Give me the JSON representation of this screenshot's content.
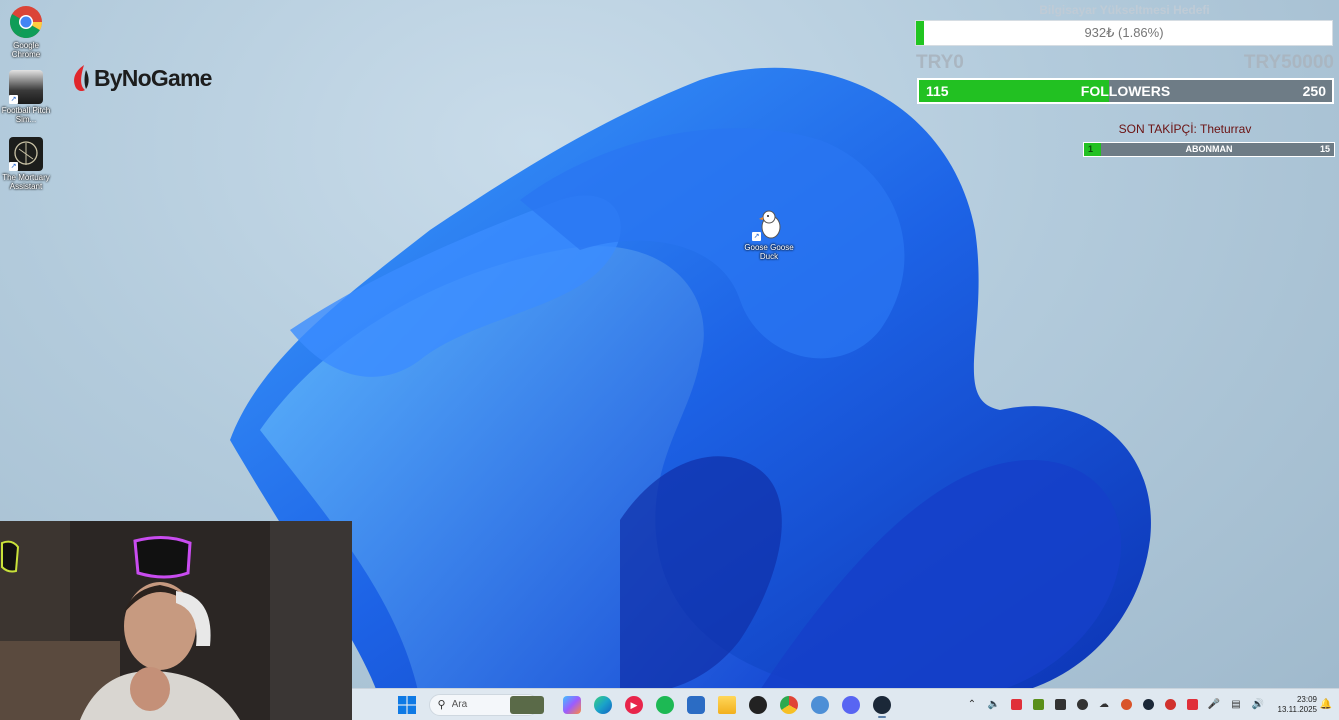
{
  "desktop": {
    "icons": [
      {
        "label": "Google Chrome",
        "icon": "chrome-icon"
      },
      {
        "label": "Football Pitch Sim...",
        "icon": "football-pitch-icon"
      },
      {
        "label": "The Mortuary Assistant",
        "icon": "mortuary-assistant-icon"
      },
      {
        "label": "Goose Goose Duck",
        "icon": "goose-icon"
      }
    ],
    "logo": "ByNoGame"
  },
  "goal": {
    "title": "Bilgisayar Yükseltmesi Hedefi",
    "amount_text": "932₺ (1.86%)",
    "progress_percent": 1.86,
    "min_label": "TRY0",
    "max_label": "TRY50000",
    "fill_color": "#21c521"
  },
  "followers": {
    "current": "115",
    "label": "FOLLOWERS",
    "target": "250",
    "progress_fraction": 0.46
  },
  "last_follower": "SON TAKİPÇİ: Theturrav",
  "subscribers": {
    "current": "1",
    "label": "ABONMAN",
    "target": "15",
    "progress_fraction": 0.067
  },
  "taskbar": {
    "search_placeholder": "Ara",
    "apps": [
      {
        "name": "copilot-icon",
        "color": "#7a5cff"
      },
      {
        "name": "edge-icon",
        "color": "#1aa3c9"
      },
      {
        "name": "media-player-icon",
        "color": "#e8254b"
      },
      {
        "name": "spotify-icon",
        "color": "#1db954"
      },
      {
        "name": "store-icon",
        "color": "#2b6cc4"
      },
      {
        "name": "file-explorer-icon",
        "color": "#f2c23a"
      },
      {
        "name": "github-icon",
        "color": "#222222"
      },
      {
        "name": "chrome-icon",
        "color": "#e04436"
      },
      {
        "name": "settings-icon",
        "color": "#4d8fd6"
      },
      {
        "name": "discord-icon",
        "color": "#5865f2"
      },
      {
        "name": "steam-icon",
        "color": "#1b2838"
      }
    ],
    "tray": [
      {
        "name": "chevron-up-icon"
      },
      {
        "name": "volume-icon"
      },
      {
        "name": "valorant-icon",
        "color": "#e0303a"
      },
      {
        "name": "nvidia-icon",
        "color": "#5a8f1a"
      },
      {
        "name": "app-tray-icon",
        "color": "#333333"
      },
      {
        "name": "obs-icon",
        "color": "#333333"
      },
      {
        "name": "cloud-icon",
        "color": "#777777"
      },
      {
        "name": "game-tray-icon",
        "color": "#d9542a"
      },
      {
        "name": "steam-tray-icon",
        "color": "#1b2838"
      },
      {
        "name": "recording-icon",
        "color": "#d1322e"
      },
      {
        "name": "red-app-icon",
        "color": "#e0303a"
      },
      {
        "name": "microphone-icon"
      },
      {
        "name": "network-icon"
      },
      {
        "name": "speaker-icon"
      }
    ],
    "time": "23:09",
    "date": "13.11.2025"
  }
}
